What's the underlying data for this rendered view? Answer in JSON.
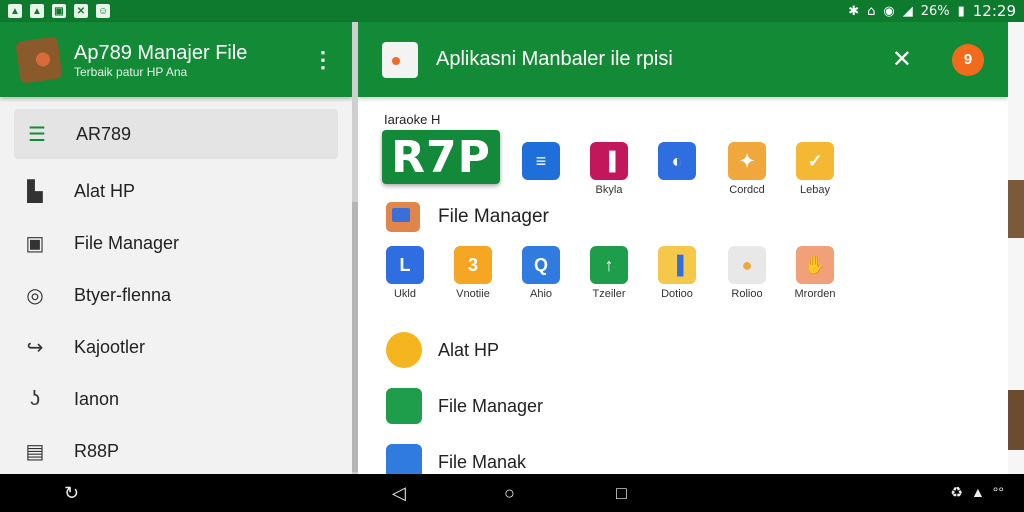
{
  "status_bar": {
    "battery_percent": "26%",
    "time": "12:29",
    "left_icons": [
      "notification-icon",
      "notification-icon",
      "photo-icon",
      "tools-icon",
      "message-icon"
    ],
    "right_icons": [
      "bluetooth-icon",
      "vibrate-icon",
      "wifi-icon",
      "signal-icon",
      "battery-icon"
    ]
  },
  "left_panel": {
    "header": {
      "title": "Ap789 Manajer File",
      "subtitle": "Terbaik patur HP Ana"
    },
    "nav_items": [
      {
        "label": "AR789",
        "icon": "list-icon",
        "active": true
      },
      {
        "label": "Alat HP",
        "icon": "sd-card-icon",
        "active": false
      },
      {
        "label": "File Manager",
        "icon": "folder-icon",
        "active": false
      },
      {
        "label": "Btyer-flenna",
        "icon": "settings-icon",
        "active": false
      },
      {
        "label": "Kajootler",
        "icon": "share-icon",
        "active": false
      },
      {
        "label": "Ianon",
        "icon": "music-icon",
        "active": false
      },
      {
        "label": "R88P",
        "icon": "document-icon",
        "active": false
      }
    ]
  },
  "right_panel": {
    "header": {
      "title": "Aplikasni Manbaler ile rpisi",
      "avatar_text": "9"
    },
    "section_label": "Iaraoke H",
    "brand_badge": "R7P",
    "top_apps": [
      {
        "label": "",
        "color": "#1e6fd9",
        "icon": "chat-icon"
      },
      {
        "label": "Bkyla",
        "color": "#c2185b",
        "icon": "box-icon"
      },
      {
        "label": "",
        "color": "#2f6ee0",
        "icon": "compass-icon"
      },
      {
        "label": "Cordcd",
        "color": "#f0a73c",
        "icon": "tag-icon"
      },
      {
        "label": "Lebay",
        "color": "#f5b833",
        "icon": "folder-check-icon"
      }
    ],
    "file_manager_heading": "File Manager",
    "grid_apps": [
      {
        "label": "Ukld",
        "color": "#2f6ee0",
        "icon": "edit-icon"
      },
      {
        "label": "Vnotiie",
        "color": "#f5a623",
        "icon": "number-icon"
      },
      {
        "label": "Ahio",
        "color": "#2f7be0",
        "icon": "search-icon"
      },
      {
        "label": "Tzeiler",
        "color": "#1e9e4a",
        "icon": "pin-icon"
      },
      {
        "label": "Dotioo",
        "color": "#f5c84a",
        "icon": "chart-icon"
      },
      {
        "label": "Rolioo",
        "color": "#e8e8e8",
        "icon": "file-icon"
      },
      {
        "label": "Mrorden",
        "color": "#f2a07a",
        "icon": "hand-icon"
      }
    ],
    "list_items": [
      {
        "label": "Alat HP",
        "color": "#f5b51f",
        "icon": "gear-icon"
      },
      {
        "label": "File Manager",
        "color": "#1e9e4a",
        "icon": "folder-icon"
      },
      {
        "label": "File Manak",
        "color": "#2f7be0",
        "icon": "file-icon"
      }
    ]
  },
  "nav_bar": {
    "back_icon": "back-icon",
    "home_icon": "home-icon",
    "recents_icon": "recents-icon",
    "right_text": "°°"
  }
}
